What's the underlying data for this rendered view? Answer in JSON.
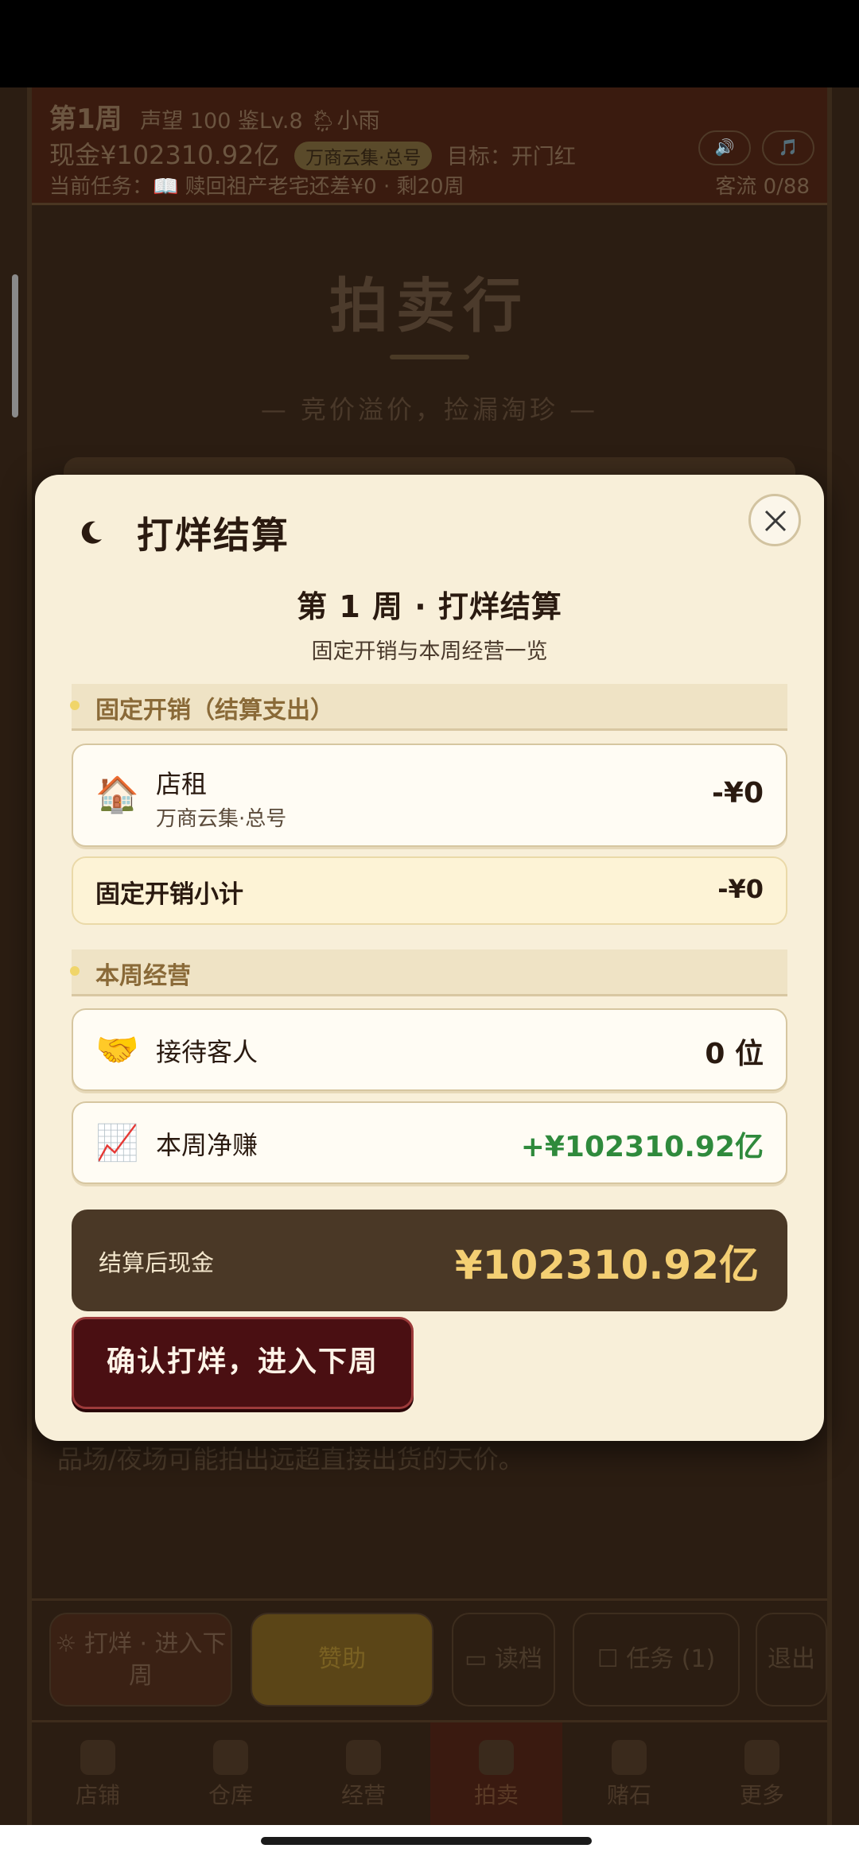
{
  "topbar": {
    "week": "第1周",
    "reputation": "声望 100",
    "appraise": "鉴Lv.8",
    "weather_icon": "rain-cloud-icon",
    "weather": "小雨",
    "cash": "现金¥102310.92亿",
    "shop_pill": "万商云集·总号",
    "goal": "目标：开门红",
    "task": "当前任务：📖 赎回祖产老宅还差¥0 · 剩20周",
    "customer_flow": "客流 0/88",
    "sound_icon": "speaker-icon",
    "music_icon": "music-note-icon"
  },
  "hall": {
    "title": "拍卖行",
    "subtitle": "— 竞价溢价，捡漏淘珍 —",
    "note": "品场/夜场可能拍出远超直接出货的天价。"
  },
  "actionbar": {
    "next_week": "打烊 · 进入下周",
    "sponsor": "赞助",
    "save": "读档",
    "tasks": "任务",
    "tasks_count": "(1)",
    "exit": "退出"
  },
  "tabs": [
    {
      "label": "店铺"
    },
    {
      "label": "仓库"
    },
    {
      "label": "经营"
    },
    {
      "label": "拍卖"
    },
    {
      "label": "赌石"
    },
    {
      "label": "更多"
    }
  ],
  "modal": {
    "title": "打烊结算",
    "icon": "moon-icon",
    "heading": "第 1 周 · 打烊结算",
    "subheading": "固定开销与本周经营一览",
    "fixed_section": "固定开销（结算支出）",
    "rent": {
      "emoji": "🏠",
      "label": "店租",
      "sub": "万商云集·总号",
      "value": "-¥0"
    },
    "fixed_subtotal": {
      "label": "固定开销小计",
      "value": "-¥0"
    },
    "ops_section": "本周经营",
    "guests": {
      "emoji": "🤝",
      "label": "接待客人",
      "value": "0 位"
    },
    "profit": {
      "emoji": "📈",
      "label": "本周净赚",
      "value": "+¥102310.92亿"
    },
    "cash_after": {
      "label": "结算后现金",
      "value": "¥102310.92亿"
    },
    "confirm_button": "确认打烊，进入下周"
  },
  "colors": {
    "modal_bg": "#f8efd9",
    "profit_green": "#2f8a3c",
    "gold": "#f4cf73",
    "confirm_bg": "#4a0f12"
  }
}
